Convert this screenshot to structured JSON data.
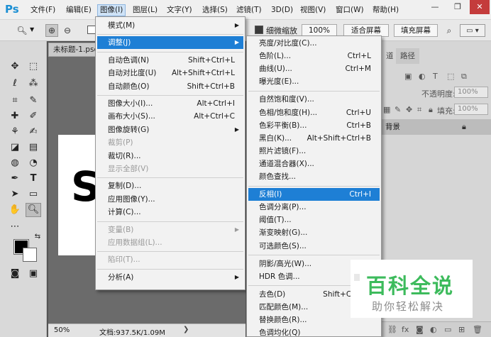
{
  "app": {
    "logo": "Ps"
  },
  "menubar": {
    "items": [
      "文件(F)",
      "编辑(E)",
      "图像(I)",
      "图层(L)",
      "文字(Y)",
      "选择(S)",
      "滤镜(T)",
      "3D(D)",
      "视图(V)",
      "窗口(W)",
      "帮助(H)"
    ],
    "active_index": 2,
    "window_controls": {
      "minimize": "—",
      "maximize": "❐",
      "close": "✕"
    }
  },
  "options_bar": {
    "zoom_tool_icon": "zoom-icon",
    "scrubby_zoom_label": "细微缩放",
    "zoom_percent_button": "100%",
    "fit_screen_button": "适合屏幕",
    "fill_screen_button": "填充屏幕"
  },
  "document": {
    "tab_title": "未标题-1.psd",
    "canvas_text": "S",
    "status_zoom": "50%",
    "status_info": "文档:937.5K/1.09M"
  },
  "image_menu": {
    "items": [
      {
        "label": "模式(M)",
        "shortcut": "",
        "submenu": true,
        "disabled": false
      },
      {
        "sep": true
      },
      {
        "label": "调整(J)",
        "shortcut": "",
        "submenu": true,
        "disabled": false,
        "highlighted": true
      },
      {
        "sep": true
      },
      {
        "label": "自动色调(N)",
        "shortcut": "Shift+Ctrl+L"
      },
      {
        "label": "自动对比度(U)",
        "shortcut": "Alt+Shift+Ctrl+L"
      },
      {
        "label": "自动颜色(O)",
        "shortcut": "Shift+Ctrl+B"
      },
      {
        "sep": true
      },
      {
        "label": "图像大小(I)...",
        "shortcut": "Alt+Ctrl+I"
      },
      {
        "label": "画布大小(S)...",
        "shortcut": "Alt+Ctrl+C"
      },
      {
        "label": "图像旋转(G)",
        "shortcut": "",
        "submenu": true
      },
      {
        "label": "裁剪(P)",
        "shortcut": "",
        "disabled": true
      },
      {
        "label": "裁切(R)...",
        "shortcut": ""
      },
      {
        "label": "显示全部(V)",
        "shortcut": "",
        "disabled": true
      },
      {
        "sep": true
      },
      {
        "label": "复制(D)...",
        "shortcut": ""
      },
      {
        "label": "应用图像(Y)...",
        "shortcut": ""
      },
      {
        "label": "计算(C)...",
        "shortcut": ""
      },
      {
        "sep": true
      },
      {
        "label": "变量(B)",
        "shortcut": "",
        "submenu": true,
        "disabled": true
      },
      {
        "label": "应用数据组(L)...",
        "shortcut": "",
        "disabled": true
      },
      {
        "sep": true
      },
      {
        "label": "陷印(T)...",
        "shortcut": "",
        "disabled": true
      },
      {
        "sep": true
      },
      {
        "label": "分析(A)",
        "shortcut": "",
        "submenu": true
      }
    ]
  },
  "adjust_menu": {
    "items": [
      {
        "label": "亮度/对比度(C)...",
        "shortcut": ""
      },
      {
        "label": "色阶(L)...",
        "shortcut": "Ctrl+L"
      },
      {
        "label": "曲线(U)...",
        "shortcut": "Ctrl+M"
      },
      {
        "label": "曝光度(E)...",
        "shortcut": ""
      },
      {
        "sep": true
      },
      {
        "label": "自然饱和度(V)...",
        "shortcut": ""
      },
      {
        "label": "色相/饱和度(H)...",
        "shortcut": "Ctrl+U"
      },
      {
        "label": "色彩平衡(B)...",
        "shortcut": "Ctrl+B"
      },
      {
        "label": "黑白(K)...",
        "shortcut": "Alt+Shift+Ctrl+B"
      },
      {
        "label": "照片滤镜(F)...",
        "shortcut": ""
      },
      {
        "label": "通道混合器(X)...",
        "shortcut": ""
      },
      {
        "label": "颜色查找...",
        "shortcut": ""
      },
      {
        "sep": true
      },
      {
        "label": "反相(I)",
        "shortcut": "Ctrl+I",
        "highlighted": true
      },
      {
        "label": "色调分离(P)...",
        "shortcut": ""
      },
      {
        "label": "阈值(T)...",
        "shortcut": ""
      },
      {
        "label": "渐变映射(G)...",
        "shortcut": ""
      },
      {
        "label": "可选颜色(S)...",
        "shortcut": ""
      },
      {
        "sep": true
      },
      {
        "label": "阴影/高光(W)...",
        "shortcut": ""
      },
      {
        "label": "HDR 色调...",
        "shortcut": ""
      },
      {
        "sep": true
      },
      {
        "label": "去色(D)",
        "shortcut": "Shift+Ctrl+U"
      },
      {
        "label": "匹配颜色(M)...",
        "shortcut": ""
      },
      {
        "label": "替换颜色(R)...",
        "shortcut": ""
      },
      {
        "label": "色调均化(Q)",
        "shortcut": ""
      }
    ]
  },
  "right_panel": {
    "tabs": [
      "道",
      "路径"
    ],
    "opacity_label": "不透明度:",
    "opacity_value": "100%",
    "fill_label": "填充:",
    "fill_value": "100%",
    "layer_name": "背景"
  },
  "watermark": {
    "title": "百科全说",
    "subtitle": "助你轻松解决"
  }
}
